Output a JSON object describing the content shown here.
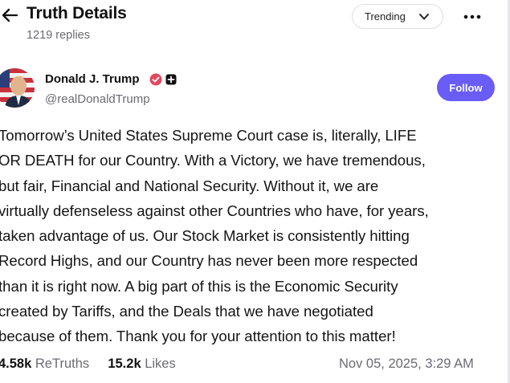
{
  "header": {
    "title": "Truth Details",
    "replies": "1219 replies",
    "filter_label": "Trending"
  },
  "post": {
    "author_name": "Donald J. Trump",
    "handle": "@realDonaldTrump",
    "follow_label": "Follow",
    "lines": [
      "Tomorrow’s United States Supreme Court case is, literally, LIFE",
      "OR DEATH for our Country. With a Victory, we have tremendous,",
      "but fair, Financial and National Security. Without it, we are",
      "virtually defenseless against other Countries who have, for years,",
      "taken advantage of us. Our Stock Market is consistently hitting",
      "Record Highs, and our Country has never been more respected",
      "than it is right now. A big part of this is the Economic Security",
      "created by Tariffs, and the Deals that we have negotiated",
      "because of them. Thank you for your attention to this matter!"
    ],
    "retruths_count": "4.58k",
    "retruths_label": "ReTruths",
    "likes_count": "15.2k",
    "likes_label": "Likes",
    "timestamp": "Nov 05, 2025, 3:29 AM"
  },
  "icons": {
    "back": "arrow-left-icon",
    "filter": "chevron-down-icon",
    "more": "more-horizontal-icon",
    "verified": "verified-icon",
    "badge": "plus-badge-icon"
  },
  "colors": {
    "accent": "#6a5cf6",
    "verified": "#e2495e",
    "muted_text": "#6b6b73",
    "text": "#111111"
  }
}
